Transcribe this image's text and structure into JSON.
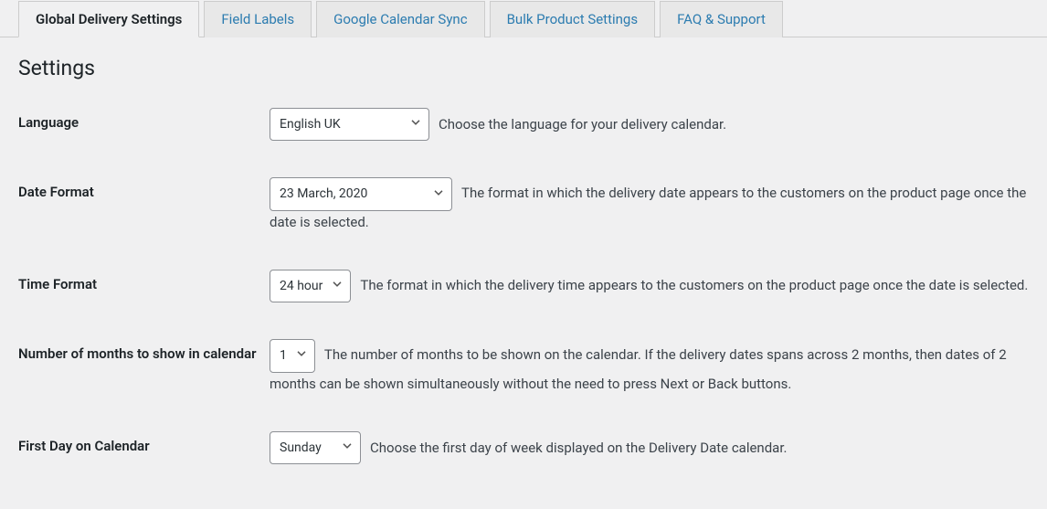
{
  "tabs": [
    {
      "label": "Global Delivery Settings",
      "active": true
    },
    {
      "label": "Field Labels",
      "active": false
    },
    {
      "label": "Google Calendar Sync",
      "active": false
    },
    {
      "label": "Bulk Product Settings",
      "active": false
    },
    {
      "label": "FAQ & Support",
      "active": false
    }
  ],
  "page_title": "Settings",
  "rows": {
    "language": {
      "label": "Language",
      "value": "English UK",
      "desc": "Choose the language for your delivery calendar."
    },
    "date_format": {
      "label": "Date Format",
      "value": "23 March, 2020",
      "desc": "The format in which the delivery date appears to the customers on the product page once the date is selected."
    },
    "time_format": {
      "label": "Time Format",
      "value": "24 hour",
      "desc": "The format in which the delivery time appears to the customers on the product page once the date is selected."
    },
    "months": {
      "label": "Number of months to show in calendar",
      "value": "1",
      "desc": "The number of months to be shown on the calendar. If the delivery dates spans across 2 months, then dates of 2 months can be shown simultaneously without the need to press Next or Back buttons."
    },
    "first_day": {
      "label": "First Day on Calendar",
      "value": "Sunday",
      "desc": "Choose the first day of week displayed on the Delivery Date calendar."
    }
  }
}
